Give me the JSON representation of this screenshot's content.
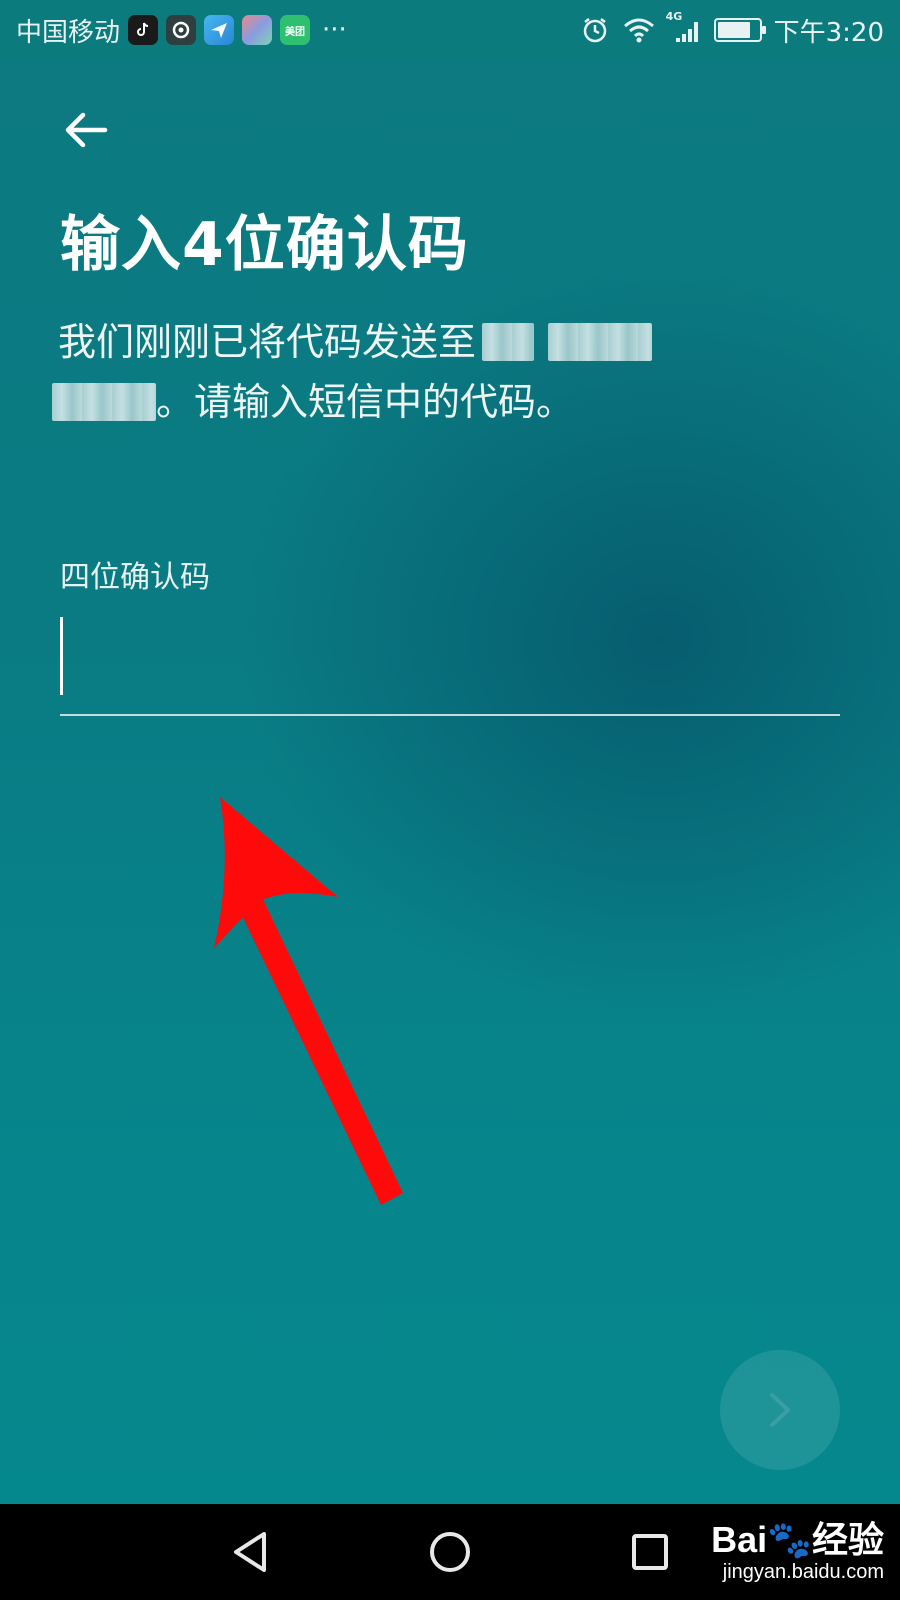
{
  "status_bar": {
    "carrier": "中国移动",
    "more": "···",
    "network_badge": "4G",
    "time": "下午3:20",
    "battery_level": 0.8
  },
  "app_icons": [
    {
      "name": "tiktok-app-icon",
      "color": "#1a1a1a"
    },
    {
      "name": "circle-app-icon",
      "color": "#3a3a3a"
    },
    {
      "name": "paper-plane-app-icon",
      "color": "#2aa0e6"
    },
    {
      "name": "cube-app-icon",
      "color": "#7a86c9"
    },
    {
      "name": "meituan-app-icon",
      "color": "#2fbf71",
      "label": "美团"
    }
  ],
  "page": {
    "title": "输入4位确认码",
    "desc_part1": "我们刚刚已将代码发送至",
    "desc_part2": "。请输入短信中的代码。",
    "field_label": "四位确认码",
    "code_value": ""
  },
  "watermark": {
    "logo": "Bai🐾经验",
    "url": "jingyan.baidu.com"
  },
  "colors": {
    "annotation_arrow": "#ff0a0a",
    "text_primary": "#ffffff"
  }
}
